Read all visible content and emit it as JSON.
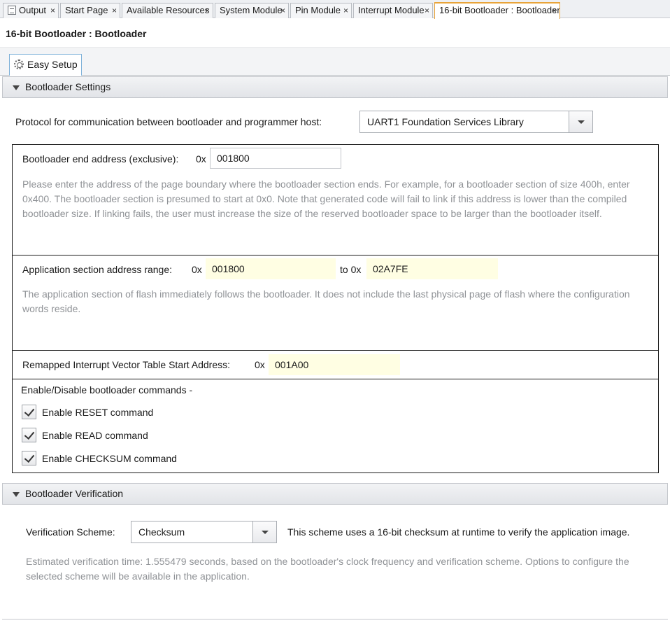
{
  "tabs": [
    {
      "label": "Output",
      "close": "×"
    },
    {
      "label": "Start Page",
      "close": "×"
    },
    {
      "label": "Available Resources",
      "close": "×"
    },
    {
      "label": "System Module",
      "close": "×"
    },
    {
      "label": "Pin Module",
      "close": "×"
    },
    {
      "label": "Interrupt Module",
      "close": "×"
    },
    {
      "label": "16-bit Bootloader : Bootloader",
      "close": "×"
    }
  ],
  "active_tab_index": 6,
  "window_title": "16-bit Bootloader : Bootloader",
  "subtab": {
    "label": "Easy Setup",
    "icon": "gear-icon"
  },
  "settings_section": {
    "title": "Bootloader Settings",
    "protocol": {
      "label": "Protocol for communication between bootloader and programmer host:",
      "value": "UART1 Foundation Services Library"
    },
    "end_address": {
      "label": "Bootloader end address (exclusive):",
      "prefix": "0x",
      "value": "001800",
      "help": "Please enter the address of the page boundary where the bootloader section ends. For example, for a bootloader section of size 400h, enter 0x400. The bootloader section is presumed to start at 0x0. Note that generated code will fail to link if this address is lower than the compiled bootloader size. If linking fails, the user must increase the size of the reserved bootloader space to be larger than the bootloader itself."
    },
    "app_range": {
      "label": "Application section address range:",
      "prefix": "0x",
      "start": "001800",
      "to_label": "to 0x",
      "end": "02A7FE",
      "help": "The application section of flash immediately follows the bootloader. It does not include the last physical page of flash where the configuration words reside."
    },
    "ivt": {
      "label": "Remapped Interrupt Vector Table Start Address:",
      "prefix": "0x",
      "value": "001A00"
    },
    "commands": {
      "title": "Enable/Disable bootloader commands -",
      "items": [
        {
          "label": "Enable RESET command",
          "checked": true
        },
        {
          "label": "Enable READ command",
          "checked": true
        },
        {
          "label": "Enable CHECKSUM command",
          "checked": true
        }
      ]
    }
  },
  "verification_section": {
    "title": "Bootloader Verification",
    "scheme_label": "Verification Scheme:",
    "scheme_value": "Checksum",
    "scheme_desc": "This scheme uses a 16-bit checksum at runtime to verify the application image.",
    "help": "Estimated verification time: 1.555479 seconds, based on the bootloader's clock frequency and verification scheme. Options to configure the selected scheme will be available in the application."
  },
  "colors": {
    "active_tab_border": "#e8a43a",
    "readonly_field_bg": "#fffee3",
    "help_text": "#8f9296"
  }
}
